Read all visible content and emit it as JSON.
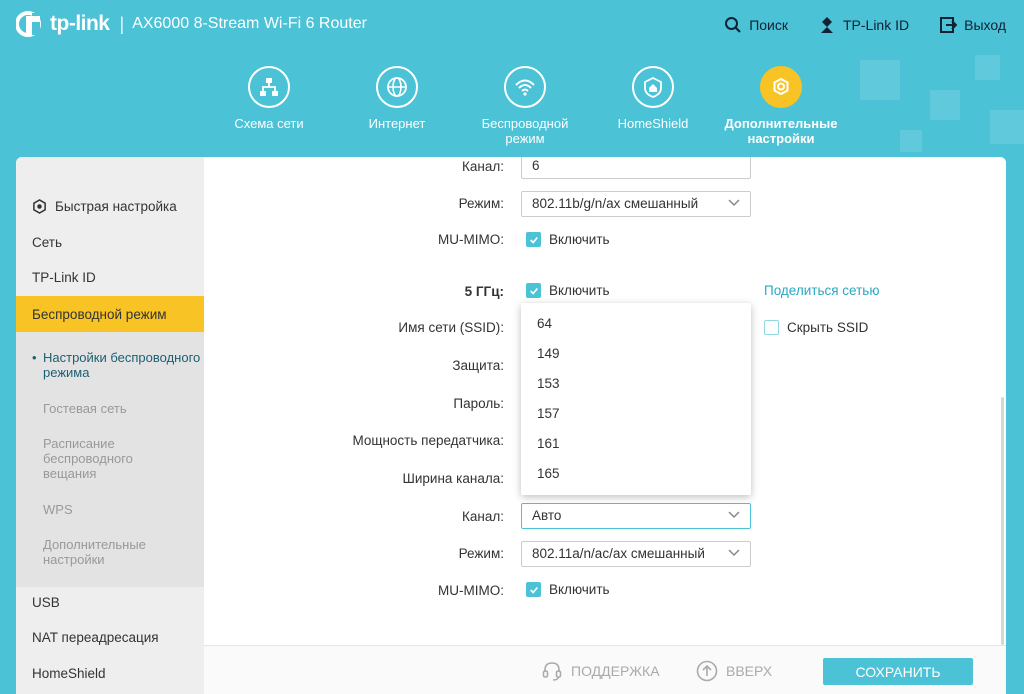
{
  "header": {
    "brand": "tp-link",
    "model": "AX6000 8-Stream Wi-Fi 6 Router",
    "links": [
      {
        "label": "Поиск",
        "icon": "search-icon"
      },
      {
        "label": "TP-Link ID",
        "icon": "user-icon"
      },
      {
        "label": "Выход",
        "icon": "logout-icon"
      }
    ]
  },
  "nav": [
    {
      "label": "Схема сети",
      "icon": "network-map-icon"
    },
    {
      "label": "Интернет",
      "icon": "globe-icon"
    },
    {
      "label": "Беспроводной режим",
      "icon": "wifi-icon"
    },
    {
      "label": "HomeShield",
      "icon": "shield-home-icon"
    },
    {
      "label": "Дополнительные настройки",
      "icon": "gear-icon",
      "active": true
    }
  ],
  "sidebar": {
    "items": [
      {
        "label": "Быстрая настройка",
        "icon": "gear-icon"
      },
      {
        "label": "Сеть"
      },
      {
        "label": "TP-Link ID"
      },
      {
        "label": "Беспроводной режим",
        "active": true
      },
      {
        "label": "USB"
      },
      {
        "label": "NAT переадресация"
      },
      {
        "label": "HomeShield"
      }
    ],
    "subitems": [
      {
        "label": "Настройки беспроводного режима",
        "current": true
      },
      {
        "label": "Гостевая сеть"
      },
      {
        "label": "Расписание беспроводного вещания"
      },
      {
        "label": "WPS"
      },
      {
        "label": "Дополнительные настройки"
      }
    ]
  },
  "form24": {
    "channel_label": "Канал:",
    "channel_value": "6",
    "mode_label": "Режим:",
    "mode_value": "802.11b/g/n/ax смешанный",
    "mumimo_label": "MU-MIMO:",
    "mumimo_check": "Включить"
  },
  "form5": {
    "band_label": "5 ГГц:",
    "band_check": "Включить",
    "share_link": "Поделиться сетью",
    "ssid_label": "Имя сети (SSID):",
    "hide_ssid": "Скрыть SSID",
    "security_label": "Защита:",
    "password_label": "Пароль:",
    "power_label": "Мощность передатчика:",
    "width_label": "Ширина канала:",
    "channel_label": "Канал:",
    "channel_value": "Авто",
    "mode_label": "Режим:",
    "mode_value": "802.11a/n/ac/ax смешанный",
    "mumimo_label": "MU-MIMO:",
    "mumimo_check": "Включить"
  },
  "dropdown": {
    "options": [
      "64",
      "149",
      "153",
      "157",
      "161",
      "165"
    ]
  },
  "footer": {
    "support": "ПОДДЕРЖКА",
    "top": "ВВЕРХ",
    "save": "СОХРАНИТЬ"
  },
  "colors": {
    "accent": "#4bc2d6",
    "highlight": "#f7c325"
  }
}
